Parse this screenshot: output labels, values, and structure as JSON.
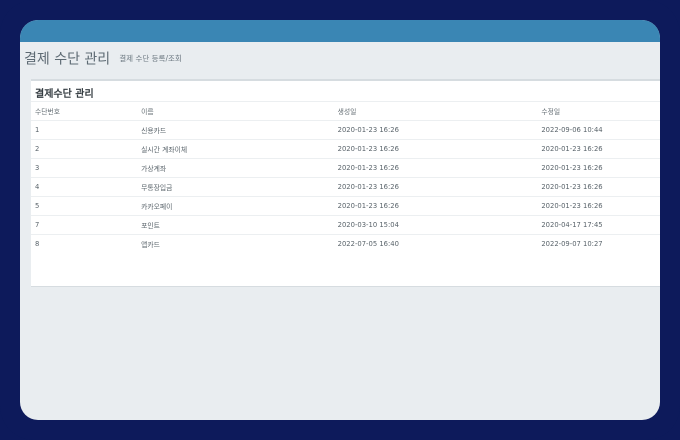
{
  "header": {
    "title": "결제 수단 관리",
    "subtitle": "결제 수단 등록/조회"
  },
  "panel": {
    "title": "결제수단 관리"
  },
  "table": {
    "columns": [
      "수단번호",
      "이름",
      "생성일",
      "수정일"
    ],
    "rows": [
      [
        "1",
        "신용카드",
        "2020-01-23 16:26",
        "2022-09-06 10:44"
      ],
      [
        "2",
        "실시간 계좌이체",
        "2020-01-23 16:26",
        "2020-01-23 16:26"
      ],
      [
        "3",
        "가상계좌",
        "2020-01-23 16:26",
        "2020-01-23 16:26"
      ],
      [
        "4",
        "무통장입금",
        "2020-01-23 16:26",
        "2020-01-23 16:26"
      ],
      [
        "5",
        "카카오페이",
        "2020-01-23 16:26",
        "2020-01-23 16:26"
      ],
      [
        "7",
        "포인트",
        "2020-03-10 15:04",
        "2020-04-17 17:45"
      ],
      [
        "8",
        "앱카드",
        "2022-07-05 16:40",
        "2022-09-07 10:27"
      ]
    ]
  },
  "colors": {
    "frame": "#0d1a5b",
    "topbar": "#3a86b4",
    "background": "#e9edf0"
  }
}
